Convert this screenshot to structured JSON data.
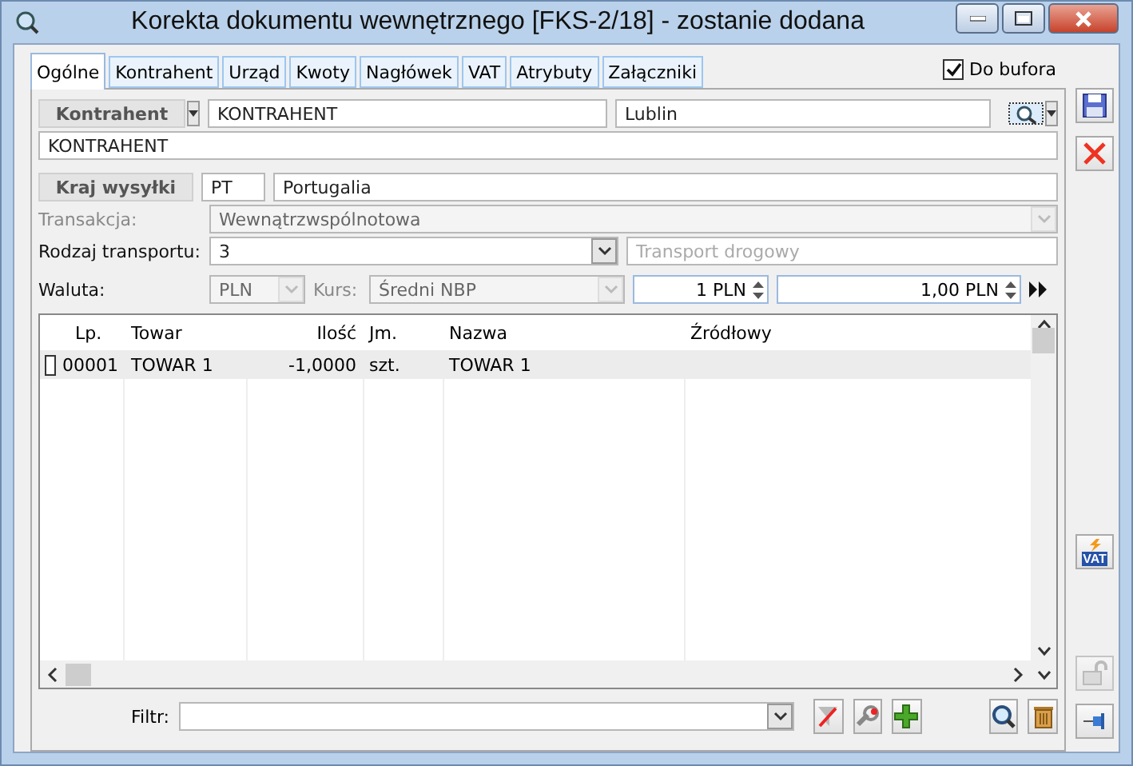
{
  "window": {
    "title": "Korekta dokumentu wewnętrznego [FKS-2/18]  - zostanie dodana"
  },
  "tabs": [
    {
      "label": "Ogólne",
      "selected": true
    },
    {
      "label": "Kontrahent",
      "selected": false
    },
    {
      "label": "Urząd",
      "selected": false
    },
    {
      "label": "Kwoty",
      "selected": false
    },
    {
      "label": "Nagłówek",
      "selected": false
    },
    {
      "label": "VAT",
      "selected": false
    },
    {
      "label": "Atrybuty",
      "selected": false
    },
    {
      "label": "Załączniki",
      "selected": false
    }
  ],
  "buffer": {
    "label": "Do bufora",
    "checked": true
  },
  "contractor": {
    "button": "Kontrahent",
    "code": "KONTRAHENT",
    "city": "Lublin",
    "name": "KONTRAHENT"
  },
  "shipping_country": {
    "button": "Kraj wysyłki",
    "code": "PT",
    "name": "Portugalia"
  },
  "transaction": {
    "label": "Transakcja:",
    "value": "Wewnątrzwspólnotowa",
    "disabled": true
  },
  "transport": {
    "label": "Rodzaj transportu:",
    "value": "3",
    "description": "Transport drogowy",
    "disabled": false
  },
  "currency": {
    "label": "Waluta:",
    "value": "PLN",
    "rate_label": "Kurs:",
    "rate_type": "Średni NBP",
    "amount": "1 PLN",
    "rate": "1,00 PLN"
  },
  "table": {
    "columns": [
      "Lp.",
      "Towar",
      "Ilość",
      "Jm.",
      "Nazwa",
      "Źródłowy"
    ],
    "rows": [
      {
        "cells": [
          "00001",
          "TOWAR 1",
          "-1,0000",
          "szt.",
          "TOWAR 1",
          ""
        ],
        "checked": false,
        "selected": true
      }
    ]
  },
  "filter": {
    "label": "Filtr:"
  },
  "vat_button": "VAT"
}
